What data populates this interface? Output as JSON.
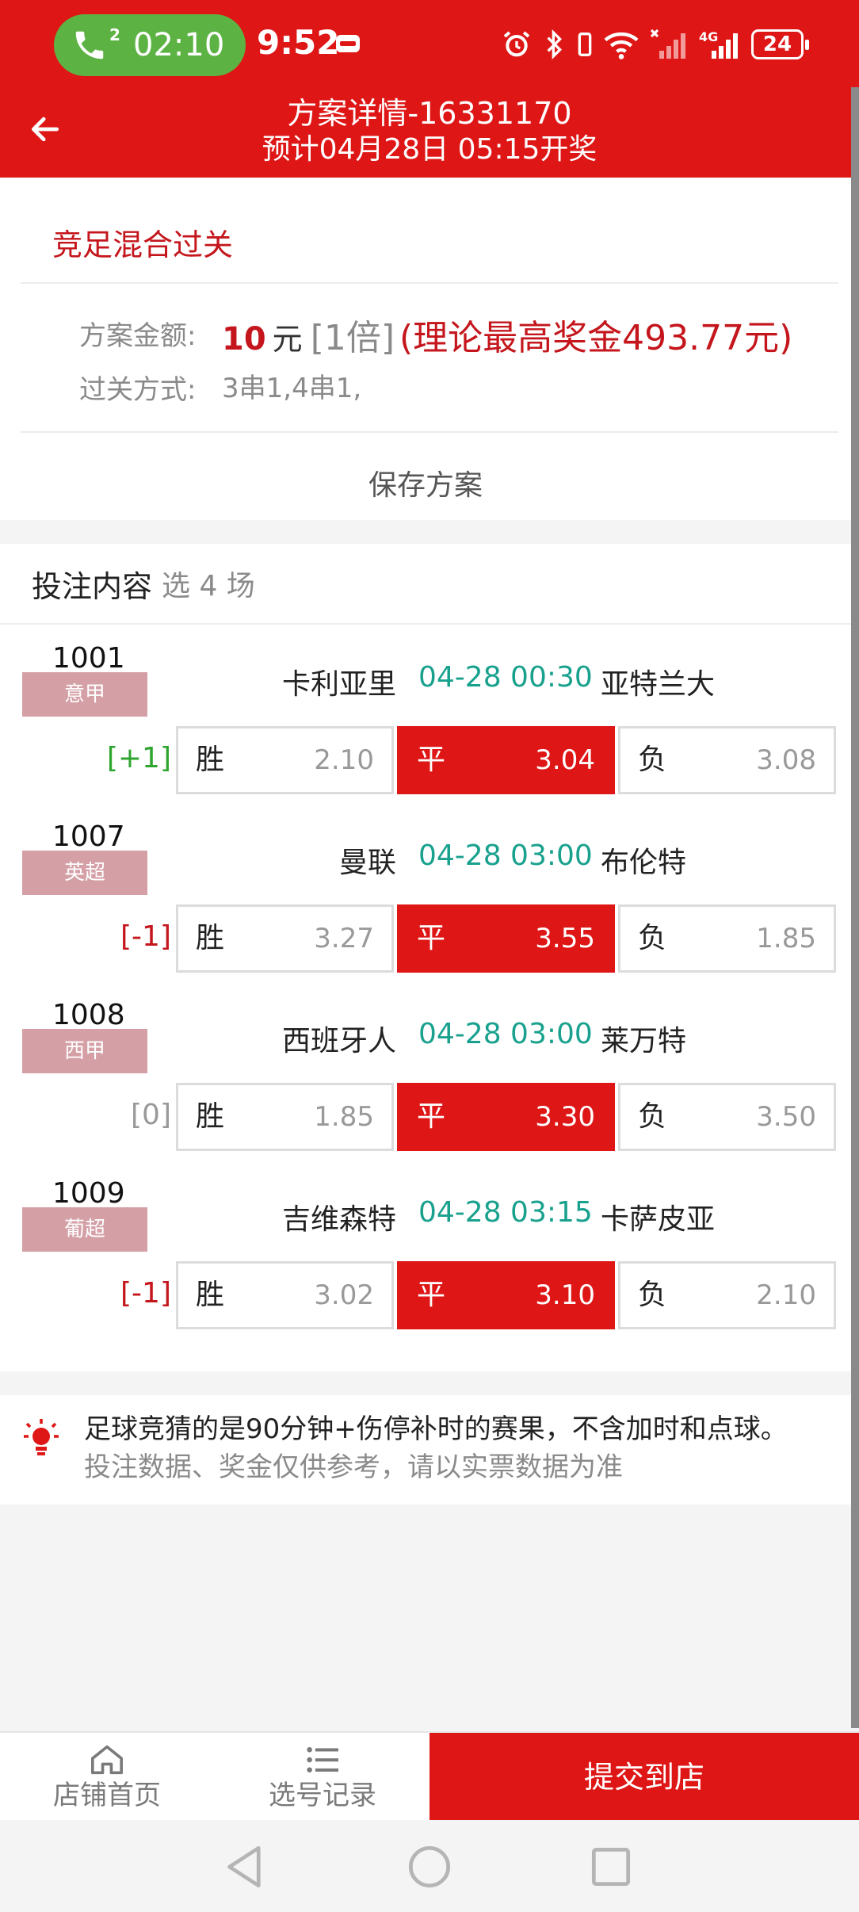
{
  "status_bar": {
    "call_timer": "02:10",
    "call_count": "2",
    "clock": "9:52",
    "battery": "24",
    "network": "4G"
  },
  "header": {
    "title": "方案详情-16331170",
    "subtitle": "预计04月28日 05:15开奖"
  },
  "plan": {
    "type": "竞足混合过关",
    "amount_label": "方案金额:",
    "amount_value": "10",
    "amount_unit": "元",
    "multiplier": "[1倍]",
    "max_prize": "(理论最高奖金493.77元)",
    "pass_label": "过关方式:",
    "pass_value": "3串1,4串1,",
    "save_label": "保存方案"
  },
  "bets": {
    "title": "投注内容",
    "subtitle": "选 4 场",
    "matches": [
      {
        "no": "1001",
        "league": "意甲",
        "home": "卡利亚里",
        "time": "04-28 00:30",
        "away": "亚特兰大",
        "handicap": "[+1]",
        "handicap_color": "#2fa52f",
        "odds": [
          {
            "label": "胜",
            "value": "2.10"
          },
          {
            "label": "平",
            "value": "3.04"
          },
          {
            "label": "负",
            "value": "3.08"
          }
        ],
        "selected": 1
      },
      {
        "no": "1007",
        "league": "英超",
        "home": "曼联",
        "time": "04-28 03:00",
        "away": "布伦特",
        "handicap": "[-1]",
        "handicap_color": "#c4161c",
        "odds": [
          {
            "label": "胜",
            "value": "3.27"
          },
          {
            "label": "平",
            "value": "3.55"
          },
          {
            "label": "负",
            "value": "1.85"
          }
        ],
        "selected": 1
      },
      {
        "no": "1008",
        "league": "西甲",
        "home": "西班牙人",
        "time": "04-28 03:00",
        "away": "莱万特",
        "handicap": "[0]",
        "handicap_color": "#999999",
        "odds": [
          {
            "label": "胜",
            "value": "1.85"
          },
          {
            "label": "平",
            "value": "3.30"
          },
          {
            "label": "负",
            "value": "3.50"
          }
        ],
        "selected": 1
      },
      {
        "no": "1009",
        "league": "葡超",
        "home": "吉维森特",
        "time": "04-28 03:15",
        "away": "卡萨皮亚",
        "handicap": "[-1]",
        "handicap_color": "#c4161c",
        "odds": [
          {
            "label": "胜",
            "value": "3.02"
          },
          {
            "label": "平",
            "value": "3.10"
          },
          {
            "label": "负",
            "value": "2.10"
          }
        ],
        "selected": 1
      }
    ]
  },
  "tip": {
    "line1": "足球竞猜的是90分钟+伤停补时的赛果，不含加时和点球。",
    "line2": "投注数据、奖金仅供参考，请以实票数据为准"
  },
  "bottom_bar": {
    "home_label": "店铺首页",
    "records_label": "选号记录",
    "submit_label": "提交到店"
  },
  "colors": {
    "brand_red": "#df1616",
    "accent_teal": "#19a18e",
    "league_tag": "#d4a0a6"
  }
}
